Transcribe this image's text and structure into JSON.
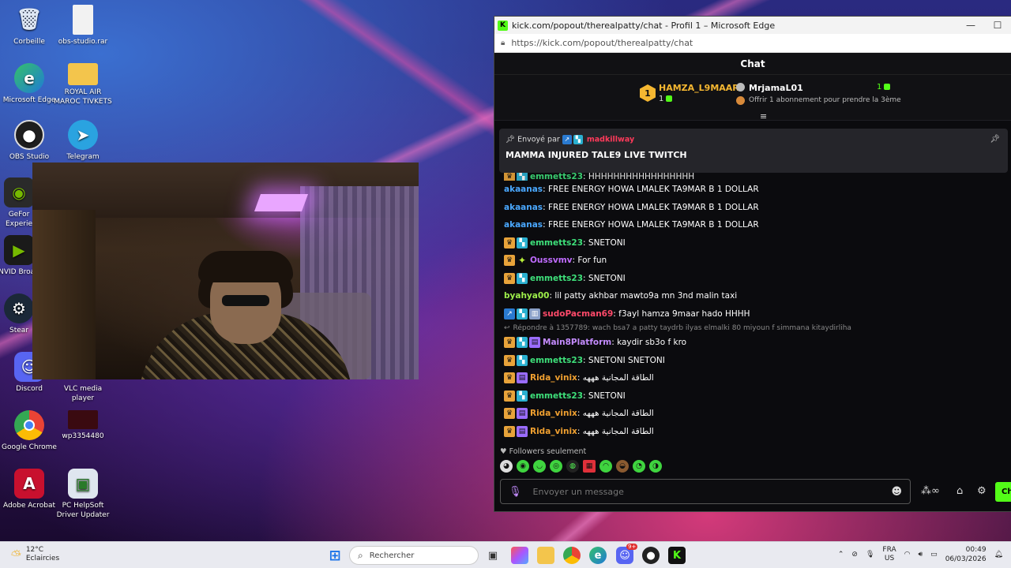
{
  "desktop": {
    "icons": [
      {
        "label": "Corbeille",
        "icon": "recycle-bin-icon"
      },
      {
        "label": "obs-studio.rar",
        "icon": "file-icon"
      },
      {
        "label": "Microsoft Edge",
        "icon": "edge-icon"
      },
      {
        "label": "ROYAL AIR MAROC TIVKETS",
        "icon": "folder-icon"
      },
      {
        "label": "OBS Studio",
        "icon": "obs-icon"
      },
      {
        "label": "Telegram",
        "icon": "telegram-icon"
      },
      {
        "label": "GeFor Experie",
        "icon": "geforce-icon"
      },
      {
        "label": "NVID Broad",
        "icon": "nvidia-icon"
      },
      {
        "label": "Stear",
        "icon": "steam-icon"
      },
      {
        "label": "Discord",
        "icon": "discord-icon"
      },
      {
        "label": "VLC media player",
        "icon": "vlc-icon"
      },
      {
        "label": "Google Chrome",
        "icon": "chrome-icon"
      },
      {
        "label": "wp3354480",
        "icon": "image-icon"
      },
      {
        "label": "Adobe Acrobat",
        "icon": "acrobat-icon"
      },
      {
        "label": "PC HelpSoft Driver Updater",
        "icon": "helpsoft-icon"
      }
    ]
  },
  "browser": {
    "title": "kick.com/popout/therealpatty/chat - Profil 1 – Microsoft Edge",
    "url": "https://kick.com/popout/therealpatty/chat",
    "minimize_glyph": "—",
    "maximize_glyph": "☐"
  },
  "chat": {
    "header": "Chat",
    "leaderboard": {
      "first_rank": "1",
      "first_user": "HAMZA_L9MAAR",
      "first_count": "1",
      "second_user": "MrjamaL01",
      "second_count": "1",
      "third_prompt": "Offrir 1 abonnement pour prendre la 3ème"
    },
    "pinned": {
      "sent_by_label": "Envoyé par",
      "sender": "madkillway",
      "message": "MAMMA INJURED TALE9 LIVE TWITCH"
    },
    "partial_row": {
      "user": "emmetts23",
      "text": ": HHHHHHHHHHHHHHHHH"
    },
    "messages": [
      {
        "user": "akaanas",
        "color": "#4aa8ff",
        "badges": [],
        "text": ": FREE ENERGY HOWA LMALEK TA9MAR B 1 DOLLAR"
      },
      {
        "user": "akaanas",
        "color": "#4aa8ff",
        "badges": [],
        "text": ": FREE ENERGY HOWA LMALEK TA9MAR B 1 DOLLAR"
      },
      {
        "user": "akaanas",
        "color": "#4aa8ff",
        "badges": [],
        "text": ": FREE ENERGY HOWA LMALEK TA9MAR B 1 DOLLAR"
      },
      {
        "user": "emmetts23",
        "color": "#3ee07a",
        "badges": [
          "crown",
          "sub"
        ],
        "text": ": SNETONI"
      },
      {
        "user": "Oussvmv",
        "color": "#c06cff",
        "badges": [
          "crown",
          "star"
        ],
        "text": ": For fun"
      },
      {
        "user": "emmetts23",
        "color": "#3ee07a",
        "badges": [
          "crown",
          "sub"
        ],
        "text": ": SNETONI"
      },
      {
        "user": "byahya00",
        "color": "#9ef04a",
        "badges": [],
        "text": ": lil patty akhbar mawto9a mn 3nd malin taxi"
      },
      {
        "user": "sudoPacman69",
        "color": "#ff4a6a",
        "badges": [
          "verified",
          "sub",
          "bot"
        ],
        "text": ": f3ayl hamza 9maar hado HHHH"
      }
    ],
    "reply": "Répondre à 1357789: wach bsa7 a patty taydrb ilyas elmalki 80 miyoun f simmana kitaydirliha",
    "messages_after": [
      {
        "user": "Main8Platform",
        "color": "#c48cff",
        "badges": [
          "crown",
          "sub",
          "gift"
        ],
        "text": ": kaydir sb3o f kro"
      },
      {
        "user": "emmetts23",
        "color": "#3ee07a",
        "badges": [
          "crown",
          "sub"
        ],
        "text": ": SNETONI SNETONI"
      },
      {
        "user": "Rida_vinix",
        "color": "#f0a030",
        "badges": [
          "crown",
          "gift"
        ],
        "text": ": الطاقة المجانية هههه"
      },
      {
        "user": "emmetts23",
        "color": "#3ee07a",
        "badges": [
          "crown",
          "sub"
        ],
        "text": ": SNETONI"
      },
      {
        "user": "Rida_vinix",
        "color": "#f0a030",
        "badges": [
          "crown",
          "gift"
        ],
        "text": ": الطاقة المجانية هههه"
      },
      {
        "user": "Rida_vinix",
        "color": "#f0a030",
        "badges": [
          "crown",
          "gift"
        ],
        "text": ": الطاقة المجانية هههه"
      }
    ],
    "followers_only": "Followers seulement",
    "input_placeholder": "Envoyer un message",
    "send_label": "Ch"
  },
  "taskbar": {
    "weather_temp": "12°C",
    "weather_desc": "Eclaircies",
    "search_placeholder": "Rechercher",
    "lang_top": "FRA",
    "lang_bottom": "US",
    "time": "00:49",
    "date": "06/03/2026",
    "discord_badge": "9+"
  },
  "colors": {
    "kick_green": "#53fc18",
    "chat_bg": "#0b0b0e"
  }
}
